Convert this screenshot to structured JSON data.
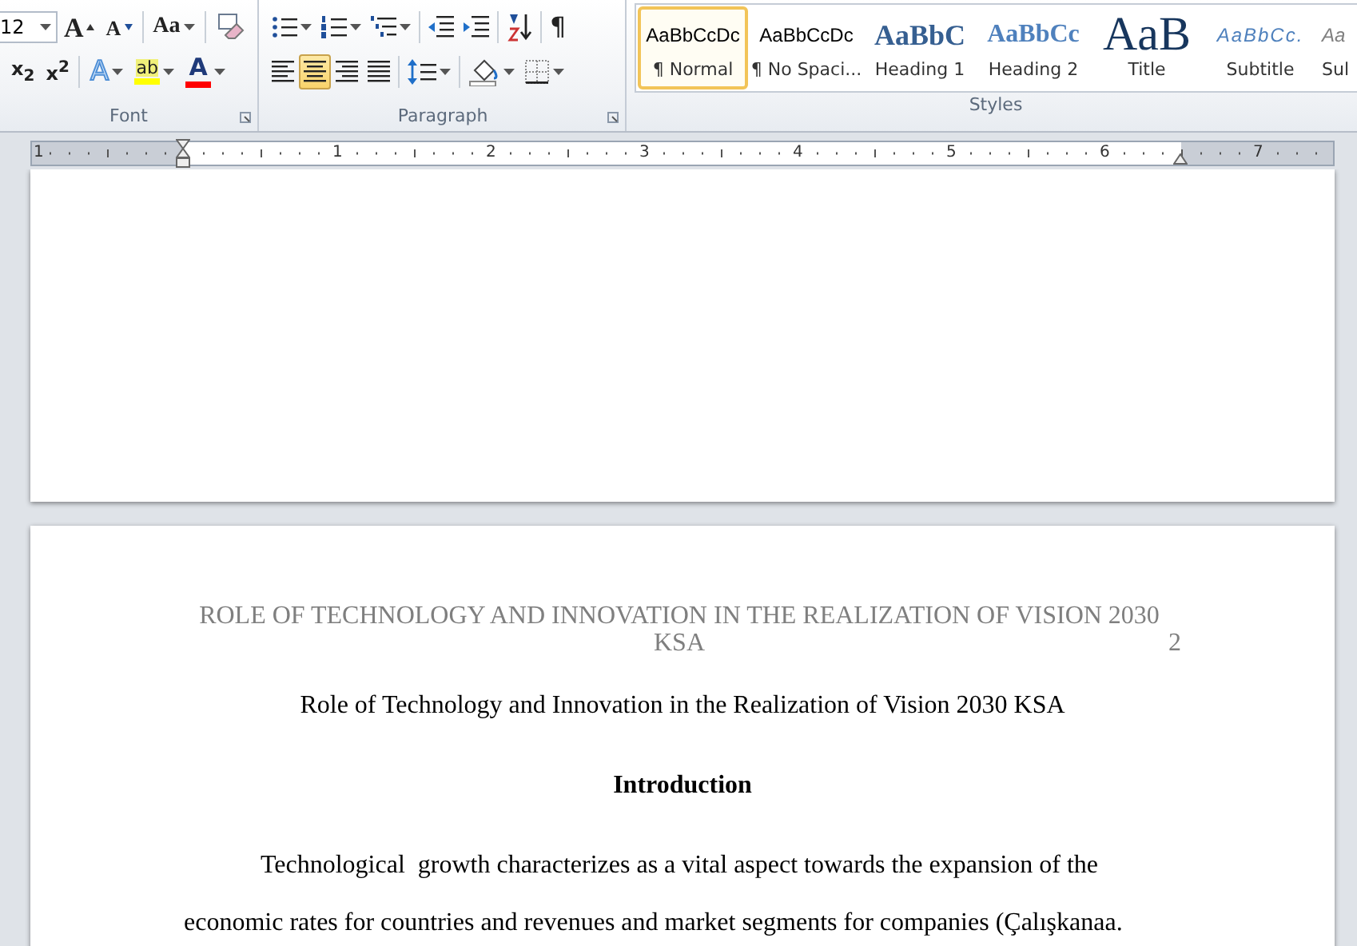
{
  "ribbon": {
    "groups": [
      {
        "kind": "font",
        "label": "Font",
        "dialog_launcher": true,
        "font_size": "12",
        "rows": [
          [
            {
              "kind": "font_size"
            },
            {
              "kind": "grow_font",
              "glyph": "A"
            },
            {
              "kind": "shrink_font",
              "glyph": "A"
            },
            {
              "kind": "separator"
            },
            {
              "kind": "change_case",
              "glyph": "Aa"
            },
            {
              "kind": "separator"
            },
            {
              "kind": "clear_formatting"
            }
          ],
          [
            {
              "kind": "subscript",
              "glyph": "x$_{2}$"
            },
            {
              "kind": "superscript",
              "glyph": "x$^{2}$"
            },
            {
              "kind": "separator"
            },
            {
              "kind": "text_effects",
              "glyph": "A"
            },
            {
              "kind": "highlight",
              "glyph": "ab"
            },
            {
              "kind": "font_color",
              "glyph": "A"
            }
          ]
        ]
      },
      {
        "kind": "paragraph",
        "label": "Paragraph",
        "dialog_launcher": true,
        "rows": [
          [
            {
              "kind": "bullets"
            },
            {
              "kind": "numbering"
            },
            {
              "kind": "multilevel"
            },
            {
              "kind": "separator"
            },
            {
              "kind": "decrease_indent"
            },
            {
              "kind": "increase_indent"
            },
            {
              "kind": "separator"
            },
            {
              "kind": "sort"
            },
            {
              "kind": "separator"
            },
            {
              "kind": "show_marks",
              "glyph": "¶"
            }
          ],
          [
            {
              "kind": "align_left",
              "selected": false
            },
            {
              "kind": "align_center",
              "selected": true
            },
            {
              "kind": "align_right",
              "selected": false
            },
            {
              "kind": "justify",
              "selected": false
            },
            {
              "kind": "separator"
            },
            {
              "kind": "line_spacing"
            },
            {
              "kind": "separator"
            },
            {
              "kind": "shading"
            },
            {
              "kind": "borders"
            }
          ]
        ]
      },
      {
        "kind": "styles",
        "label": "Styles",
        "dialog_launcher": false,
        "styles": [
          {
            "kind": "normal",
            "preview": "AaBbCcDc",
            "label": "¶ Normal",
            "selected": true
          },
          {
            "kind": "no_spacing",
            "preview": "AaBbCcDc",
            "label": "¶ No Spaci...",
            "selected": false
          },
          {
            "kind": "heading1",
            "preview": "AaBbC",
            "label": "Heading 1",
            "selected": false
          },
          {
            "kind": "heading2",
            "preview": "AaBbCc",
            "label": "Heading 2",
            "selected": false
          },
          {
            "kind": "title",
            "preview": "AaB",
            "label": "Title",
            "selected": false
          },
          {
            "kind": "subtitle",
            "preview": "AaBbCc.",
            "label": "Subtitle",
            "selected": false
          },
          {
            "kind": "subtle",
            "preview": "Aa",
            "label": "Sul",
            "selected": false
          }
        ]
      }
    ]
  },
  "ruler": {
    "numbers": [
      "1",
      "1",
      "2",
      "3",
      "4",
      "5",
      "6",
      "7"
    ]
  },
  "document": {
    "pages": [
      {
        "kind": "blank"
      },
      {
        "kind": "text",
        "header": {
          "text": "ROLE OF TECHNOLOGY AND INNOVATION IN THE REALIZATION OF VISION 2030 KSA",
          "page_number": "2"
        },
        "title": "Role of Technology and Innovation in the Realization of Vision 2030 KSA",
        "heading": "Introduction",
        "paragraph": "Technological  growth characterizes as a vital aspect towards the expansion of the economic rates for countries and revenues and market segments for companies (Çalışkanaa."
      }
    ]
  }
}
